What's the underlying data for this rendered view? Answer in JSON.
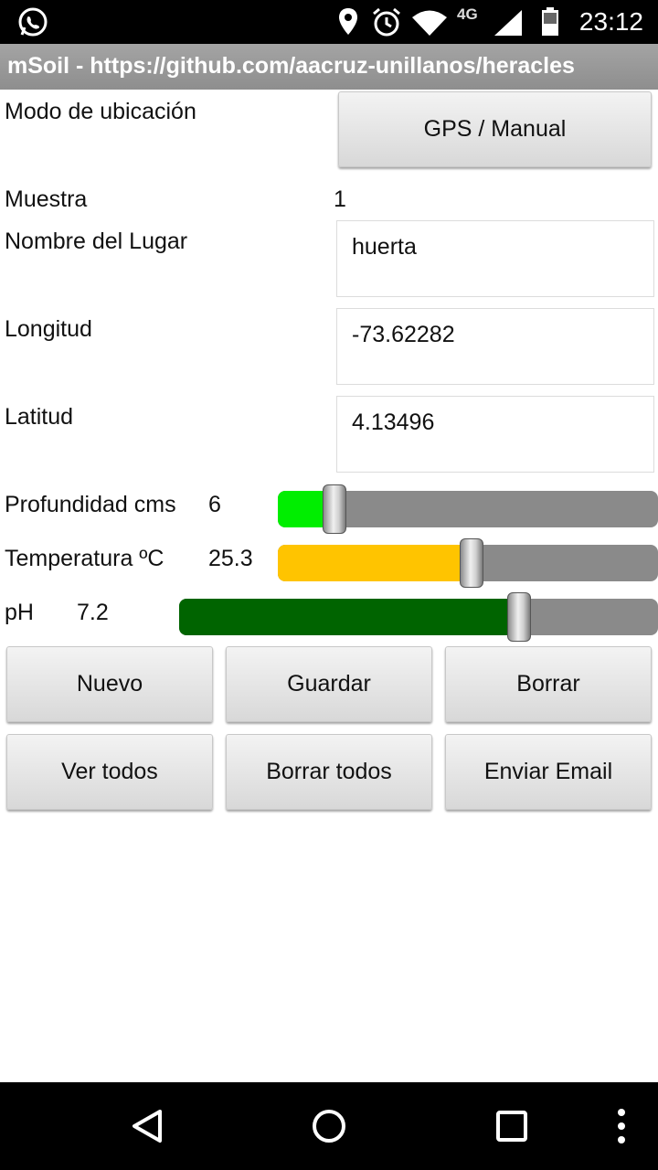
{
  "status_bar": {
    "time": "23:12",
    "network": "4G",
    "icons": [
      "whatsapp-icon",
      "location-icon",
      "alarm-icon",
      "wifi-icon",
      "signal-icon",
      "battery-icon"
    ]
  },
  "app": {
    "title": "mSoil - https://github.com/aacruz-unillanos/heracles"
  },
  "form": {
    "location_mode_label": "Modo de ubicación",
    "location_mode_button": "GPS / Manual",
    "sample_label": "Muestra",
    "sample_value": "1",
    "place_label": "Nombre del Lugar",
    "place_value": "huerta",
    "longitude_label": "Longitud",
    "longitude_value": "-73.62282",
    "latitude_label": "Latitud",
    "latitude_value": "4.13496"
  },
  "sliders": {
    "depth": {
      "label": "Profundidad cms",
      "value": "6",
      "fill_fraction": 0.15,
      "color": "#00ee00"
    },
    "temperature": {
      "label": "Temperatura ºC",
      "value": "25.3",
      "fill_fraction": 0.51,
      "color": "#ffc400"
    },
    "ph": {
      "label": "pH",
      "value": "7.2",
      "fill_fraction": 0.71,
      "color": "#006400"
    }
  },
  "buttons": {
    "new": "Nuevo",
    "save": "Guardar",
    "delete": "Borrar",
    "view_all": "Ver todos",
    "delete_all": "Borrar todos",
    "send_email": "Enviar Email"
  },
  "nav_bar": {
    "icons": [
      "back-icon",
      "home-icon",
      "recents-icon",
      "more-vert-icon"
    ]
  }
}
